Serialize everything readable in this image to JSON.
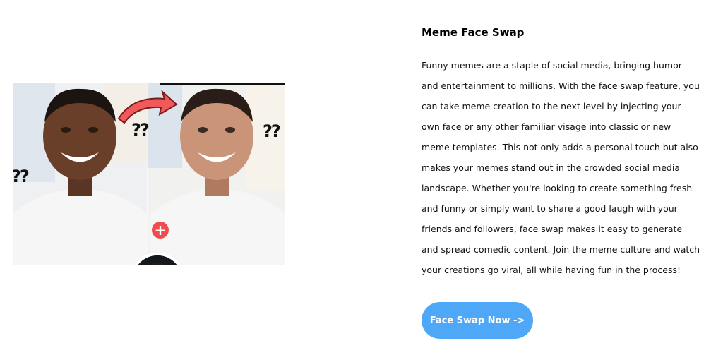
{
  "section": {
    "title": "Meme Face Swap",
    "description": "Funny memes are a staple of social media, bringing humor and entertainment to millions. With the face swap feature, you can take meme creation to the next level by injecting your own face or any other familiar visage into classic or new meme templates. This not only adds a personal touch but also makes your memes stand out in the crowded social media landscape. Whether you're looking to create something fresh and funny or simply want to share a good laugh with your friends and followers, face swap makes it easy to generate and spread comedic content. Join the meme culture and watch your creations go viral, all while having fun in the process!",
    "cta_label": "Face Swap Now ->"
  },
  "image": {
    "question_marks": [
      "??",
      "??",
      "??"
    ],
    "plus_symbol": "+"
  },
  "colors": {
    "cta_background": "#4ea8f7",
    "plus_badge": "#f14b4b",
    "arrow": "#f05a5a"
  }
}
